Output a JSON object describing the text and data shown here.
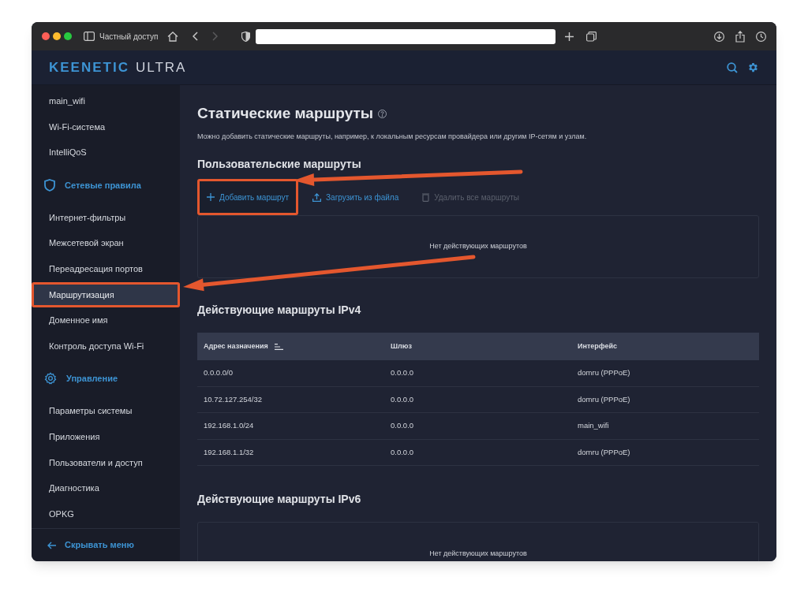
{
  "browser": {
    "private_label": "Частный доступ"
  },
  "header": {
    "brand": "KEENETIC",
    "model": "ULTRA"
  },
  "sidebar": {
    "items": [
      {
        "kind": "item",
        "label": "main_wifi",
        "selected": false,
        "annotated": false
      },
      {
        "kind": "item",
        "label": "Wi-Fi-система",
        "selected": false,
        "annotated": false
      },
      {
        "kind": "item",
        "label": "IntelliQoS",
        "selected": false,
        "annotated": false
      },
      {
        "kind": "section",
        "label": "Сетевые правила"
      },
      {
        "kind": "item",
        "label": "Интернет-фильтры",
        "selected": false,
        "annotated": false
      },
      {
        "kind": "item",
        "label": "Межсетевой экран",
        "selected": false,
        "annotated": false
      },
      {
        "kind": "item",
        "label": "Переадресация портов",
        "selected": false,
        "annotated": false
      },
      {
        "kind": "item",
        "label": "Маршрутизация",
        "selected": true,
        "annotated": true
      },
      {
        "kind": "item",
        "label": "Доменное имя",
        "selected": false,
        "annotated": false
      },
      {
        "kind": "item",
        "label": "Контроль доступа Wi-Fi",
        "selected": false,
        "annotated": false
      },
      {
        "kind": "section",
        "label": "Управление"
      },
      {
        "kind": "item",
        "label": "Параметры системы",
        "selected": false,
        "annotated": false
      },
      {
        "kind": "item",
        "label": "Приложения",
        "selected": false,
        "annotated": false
      },
      {
        "kind": "item",
        "label": "Пользователи и доступ",
        "selected": false,
        "annotated": false
      },
      {
        "kind": "item",
        "label": "Диагностика",
        "selected": false,
        "annotated": false
      },
      {
        "kind": "item",
        "label": "OPKG",
        "selected": false,
        "annotated": false
      }
    ],
    "hide_menu": "Скрывать меню"
  },
  "page": {
    "title": "Статические маршруты",
    "description": "Можно добавить статические маршруты, например, к локальным ресурсам провайдера или другим IP-сетям и узлам.",
    "user_routes": {
      "heading": "Пользовательские маршруты",
      "actions": [
        {
          "label": "Добавить маршрут",
          "disabled": false,
          "annotated": true
        },
        {
          "label": "Загрузить из файла",
          "disabled": false,
          "annotated": false
        },
        {
          "label": "Удалить все маршруты",
          "disabled": true,
          "annotated": false
        }
      ],
      "empty": "Нет действующих маршрутов"
    },
    "ipv4": {
      "heading": "Действующие маршруты IPv4",
      "columns": [
        {
          "label": "Адрес назначения",
          "sorted": true
        },
        {
          "label": "Шлюз",
          "sorted": false
        },
        {
          "label": "Интерфейс",
          "sorted": false
        }
      ],
      "rows": [
        [
          "0.0.0.0/0",
          "0.0.0.0",
          "domru (PPPoE)"
        ],
        [
          "10.72.127.254/32",
          "0.0.0.0",
          "domru (PPPoE)"
        ],
        [
          "192.168.1.0/24",
          "0.0.0.0",
          "main_wifi"
        ],
        [
          "192.168.1.1/32",
          "0.0.0.0",
          "domru (PPPoE)"
        ]
      ]
    },
    "ipv6": {
      "heading": "Действующие маршруты IPv6",
      "empty": "Нет действующих маршрутов"
    }
  }
}
